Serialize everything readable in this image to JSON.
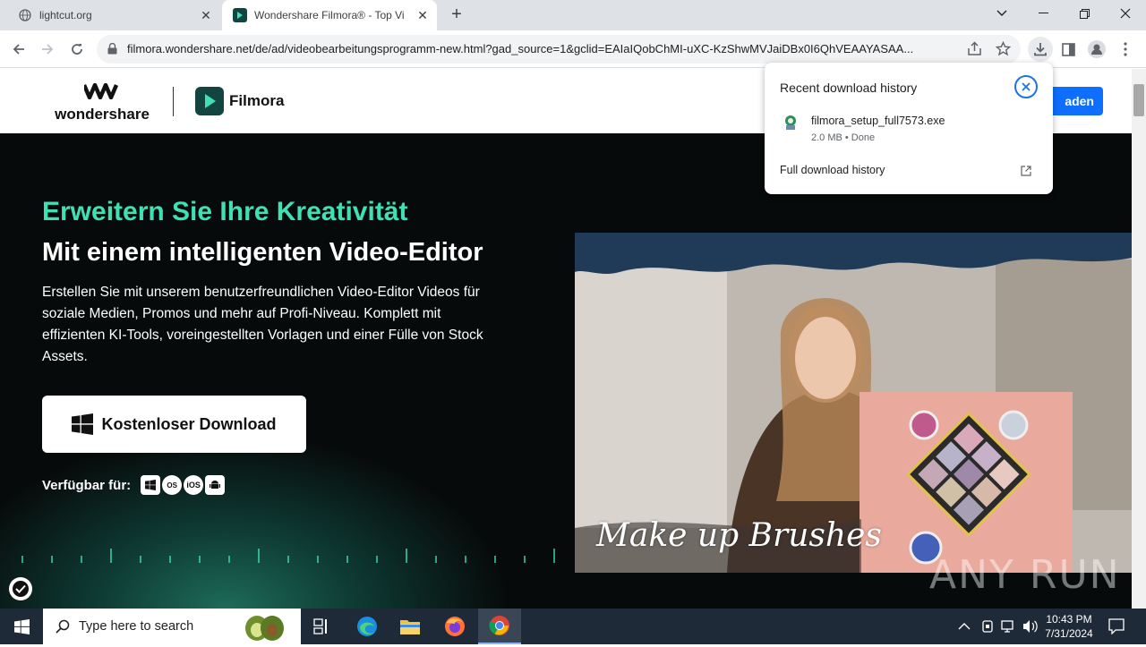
{
  "browser": {
    "tabs": [
      {
        "title": "lightcut.org",
        "active": false
      },
      {
        "title": "Wondershare Filmora® - Top Vi",
        "active": true
      }
    ],
    "url": "filmora.wondershare.net/de/ad/videobearbeitungsprogramm-new.html?gad_source=1&gclid=EAIaIQobChMI-uXC-KzShwMVJaiDBx0I6QhVEAAYASAA..."
  },
  "header": {
    "brand": "wondershare",
    "product": "Filmora",
    "cta_partial": "aden"
  },
  "hero": {
    "headline_1": "Erweitern Sie Ihre Kreativität",
    "headline_2": "Mit einem intelligenten Video-Editor",
    "description": "Erstellen Sie mit unserem benutzerfreundlichen Video-Editor Videos für soziale Medien, Promos und mehr auf Profi-Niveau. Komplett mit effizienten KI-Tools, voreingestellten Vorlagen und einer Fülle von Stock Assets.",
    "download_button": "Kostenloser Download",
    "available_label": "Verfügbar für:",
    "os_badges": [
      "windows-icon",
      "macos-icon",
      "ios-icon",
      "android-icon"
    ],
    "macos_label": "OS",
    "ios_label": "iOS",
    "photo_caption": "Make up Brushes"
  },
  "download_popup": {
    "title": "Recent download history",
    "file_name": "filmora_setup_full7573.exe",
    "file_meta": "2.0 MB • Done",
    "full_history": "Full download history"
  },
  "watermark": "ANY RUN",
  "taskbar": {
    "search_placeholder": "Type here to search",
    "time": "10:43 PM",
    "date": "7/31/2024"
  },
  "colors": {
    "accent_green": "#3fe0b4",
    "chrome_blue": "#1a73e8"
  }
}
